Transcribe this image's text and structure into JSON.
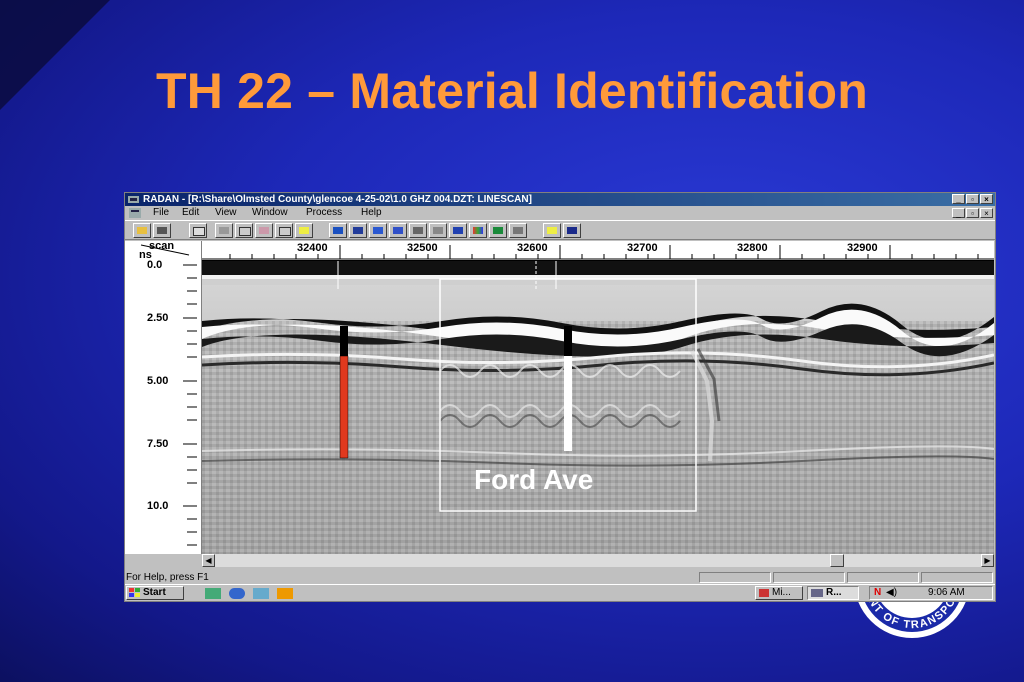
{
  "slide": {
    "title": "TH 22 – Material Identification"
  },
  "window": {
    "title": "RADAN - [R:\\Share\\Olmsted County\\glencoe 4-25-02\\1.0 GHZ 004.DZT:  LINESCAN]",
    "controls": [
      "_",
      "▫",
      "×"
    ]
  },
  "menu": [
    "File",
    "Edit",
    "View",
    "Window",
    "Process",
    "Help"
  ],
  "ruler": {
    "corner_top": "scan",
    "corner_bottom": "ns",
    "scan_ticks": [
      "32400",
      "32500",
      "32600",
      "32700",
      "32800",
      "32900"
    ],
    "depth_ticks": [
      "0.0",
      "2.50",
      "5.00",
      "7.50",
      "10.0"
    ]
  },
  "annotation": {
    "label": "Ford Ave"
  },
  "statusbar": {
    "help": "For Help, press F1"
  },
  "taskbar": {
    "start": "Start",
    "tasks": [
      "Mi...",
      "R..."
    ],
    "clock": "9:06 AM"
  },
  "seal": {
    "text": "NT OF TRANSPO"
  },
  "colors": {
    "title": "#ff9a3a",
    "background": "#1d28b8",
    "titlebar_start": "#0a246a",
    "titlebar_end": "#3a6ea5",
    "marker_red": "#e0391e"
  }
}
